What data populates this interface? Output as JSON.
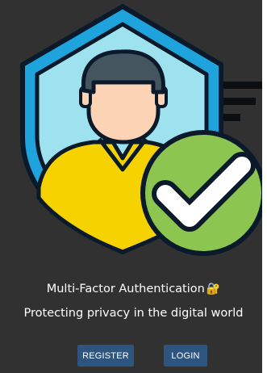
{
  "hero": {
    "illustration": "user-shield-verified-icon",
    "colors": {
      "shield_outer": "#1ea3dc",
      "shield_inner": "#9fe2ef",
      "shirt": "#f6d300",
      "skin": "#fdd3b5",
      "hair": "#44555f",
      "check_circle": "#8dc551",
      "outline": "#0b1a2a"
    }
  },
  "content": {
    "title": "Multi-Factor Authentication",
    "title_icon": "lock-icon",
    "subtitle": "Protecting privacy in the digital world"
  },
  "actions": {
    "register_label": "REGISTER",
    "login_label": "LOGIN"
  },
  "theme": {
    "panel_bg": "#313131",
    "button_bg": "#2d5580",
    "text": "#ffffff"
  }
}
